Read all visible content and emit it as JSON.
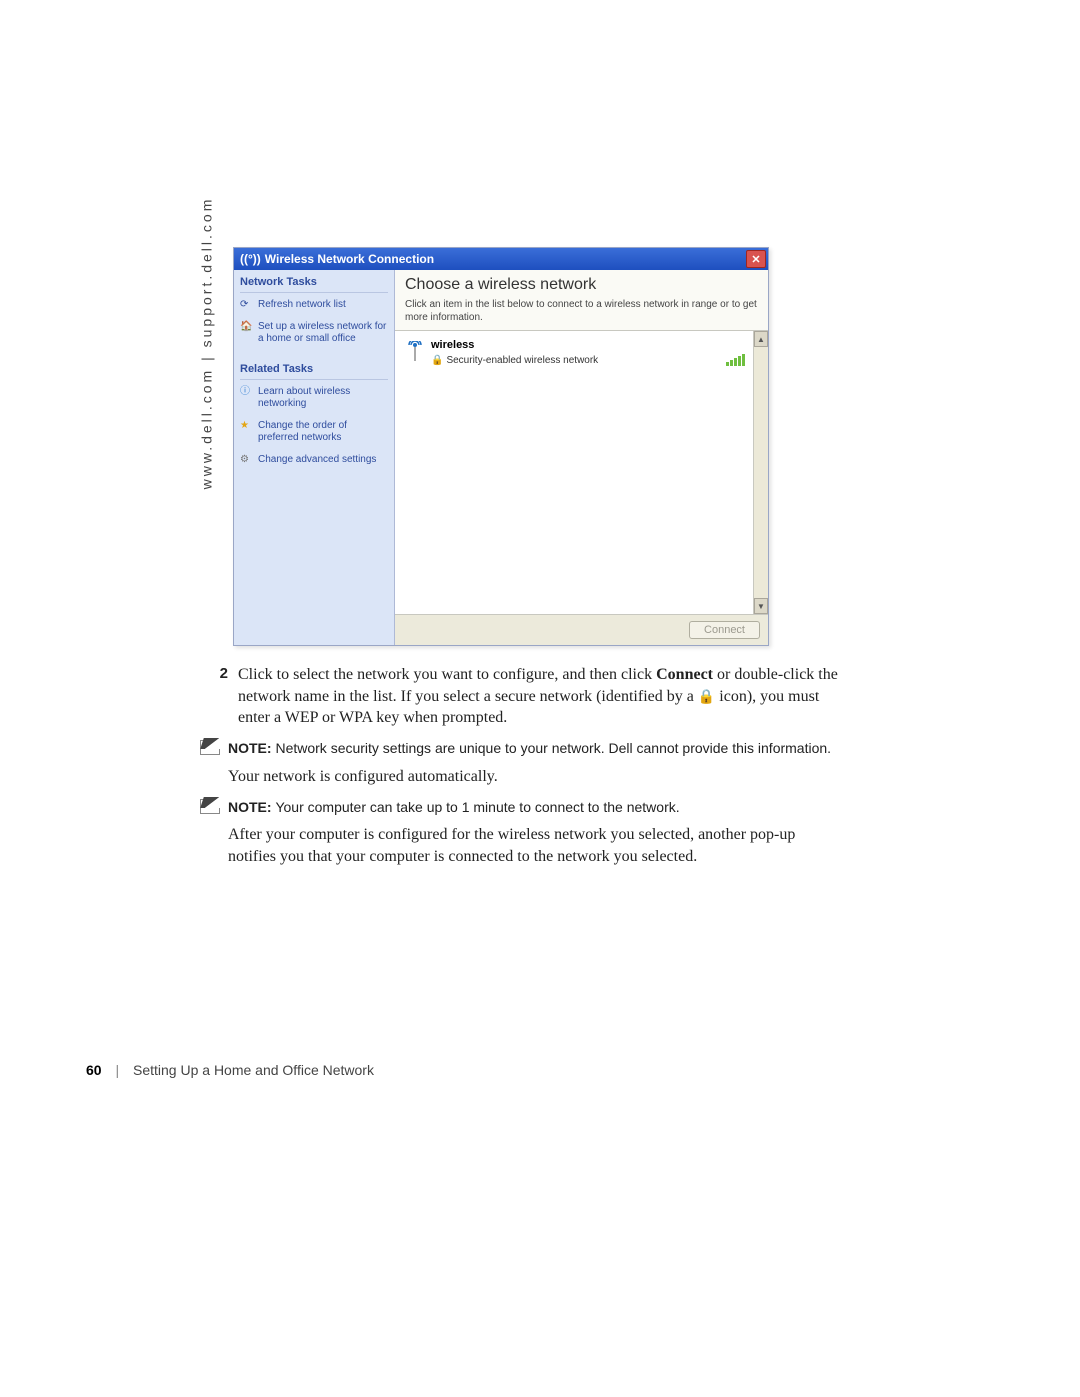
{
  "sidebar_url": "www.dell.com | support.dell.com",
  "window": {
    "title": "Wireless Network Connection",
    "left": {
      "hdr1": "Network Tasks",
      "refresh": "Refresh network list",
      "setup": "Set up a wireless network for a home or small office",
      "hdr2": "Related Tasks",
      "learn": "Learn about wireless networking",
      "order": "Change the order of preferred networks",
      "adv": "Change advanced settings"
    },
    "right": {
      "heading": "Choose a wireless network",
      "sub": "Click an item in the list below to connect to a wireless network in range or to get more information.",
      "net_name": "wireless",
      "net_sec": "Security-enabled wireless network",
      "connect": "Connect"
    }
  },
  "step2": {
    "num": "2",
    "t1": "Click to select the network you want to configure, and then click ",
    "connect": "Connect",
    "t2": " or double-click the network name in the list. If you select a secure network (identified by a ",
    "t3": " icon), you must enter a WEP or WPA key when prompted."
  },
  "note1": {
    "label": "NOTE: ",
    "text": "Network security settings are unique to your network. Dell cannot provide this information."
  },
  "para1": "Your network is configured automatically.",
  "note2": {
    "label": "NOTE: ",
    "text": "Your computer can take up to 1 minute to connect to the network."
  },
  "para2": "After your computer is configured for the wireless network you selected, another pop-up notifies you that your computer is connected to the network you selected.",
  "footer": {
    "page": "60",
    "section": "Setting Up a Home and Office Network"
  }
}
